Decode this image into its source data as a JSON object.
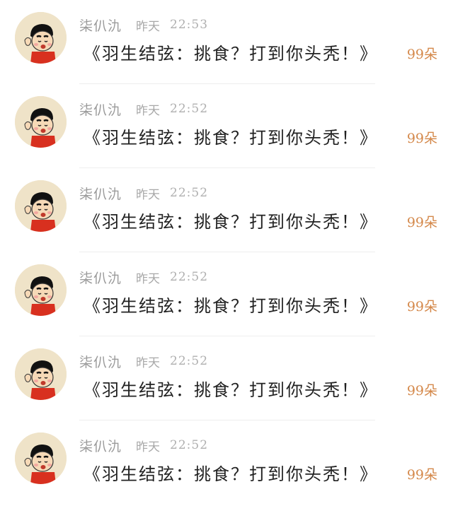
{
  "colors": {
    "count_accent": "#d4884a",
    "meta_gray": "#a3a3a3",
    "avatar_bg": "#efe3c8"
  },
  "items": [
    {
      "avatar_icon": "crayon-shin-chan-avatar",
      "name": "柒仈氿",
      "day": "昨天",
      "time": "22:53",
      "message": "《羽生结弦：挑食？打到你头秃！》",
      "count": "99朵"
    },
    {
      "avatar_icon": "crayon-shin-chan-avatar",
      "name": "柒仈氿",
      "day": "昨天",
      "time": "22:52",
      "message": "《羽生结弦：挑食？打到你头秃！》",
      "count": "99朵"
    },
    {
      "avatar_icon": "crayon-shin-chan-avatar",
      "name": "柒仈氿",
      "day": "昨天",
      "time": "22:52",
      "message": "《羽生结弦：挑食？打到你头秃！》",
      "count": "99朵"
    },
    {
      "avatar_icon": "crayon-shin-chan-avatar",
      "name": "柒仈氿",
      "day": "昨天",
      "time": "22:52",
      "message": "《羽生结弦：挑食？打到你头秃！》",
      "count": "99朵"
    },
    {
      "avatar_icon": "crayon-shin-chan-avatar",
      "name": "柒仈氿",
      "day": "昨天",
      "time": "22:52",
      "message": "《羽生结弦：挑食？打到你头秃！》",
      "count": "99朵"
    },
    {
      "avatar_icon": "crayon-shin-chan-avatar",
      "name": "柒仈氿",
      "day": "昨天",
      "time": "22:52",
      "message": "《羽生结弦：挑食？打到你头秃！》",
      "count": "99朵"
    }
  ]
}
